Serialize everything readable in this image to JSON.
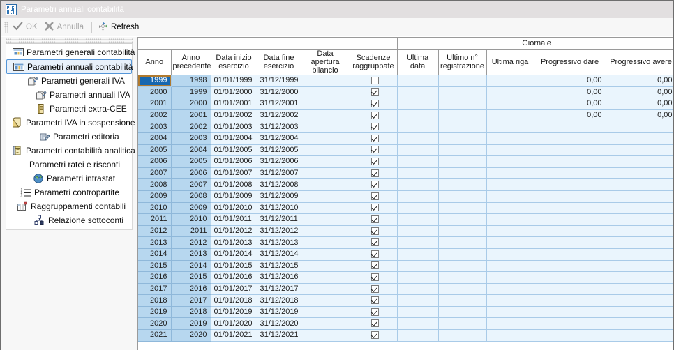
{
  "window": {
    "title": "Parametri annuali contabilità",
    "icon": "app-barcode-icon"
  },
  "toolbar": {
    "ok_label": "OK",
    "cancel_label": "Annulla",
    "refresh_label": "Refresh"
  },
  "sidebar": {
    "items": [
      {
        "label": "Parametri generali contabilità",
        "icon": "form-window-icon",
        "indent": 0,
        "selected": false
      },
      {
        "label": "Parametri annuali contabilità",
        "icon": "form-window-icon",
        "indent": 0,
        "selected": true
      },
      {
        "label": "Parametri generali IVA",
        "icon": "documents-icon",
        "indent": 1,
        "selected": false
      },
      {
        "label": "Parametri annuali IVA",
        "icon": "documents-icon",
        "indent": 2,
        "selected": false
      },
      {
        "label": "Parametri extra-CEE",
        "icon": "book-icon",
        "indent": 2,
        "selected": false
      },
      {
        "label": "Parametri IVA in sospensione",
        "icon": "books-icon",
        "indent": 5,
        "selected": false
      },
      {
        "label": "Parametri editoria",
        "icon": "write-note-icon",
        "indent": 4,
        "selected": false
      },
      {
        "label": "Parametri contabilità analitica",
        "icon": "ledger-icon",
        "indent": 5,
        "selected": false
      },
      {
        "label": "Parametri ratei e risconti",
        "icon": "none-icon",
        "indent": 6,
        "selected": false
      },
      {
        "label": "Parametri intrastat",
        "icon": "globe-icon",
        "indent": 7,
        "selected": false
      },
      {
        "label": "Parametri contropartite",
        "icon": "numbered-list-icon",
        "indent": 8,
        "selected": false
      },
      {
        "label": "Raggruppamenti contabili",
        "icon": "grid-flag-icon",
        "indent": 9,
        "selected": false
      },
      {
        "label": "Relazione sottoconti",
        "icon": "hierarchy-icon",
        "indent": 10,
        "selected": false
      }
    ]
  },
  "grid": {
    "group_headers": [
      {
        "label": "",
        "span": 6
      },
      {
        "label": "Giornale",
        "span": 5
      }
    ],
    "columns": [
      {
        "key": "anno",
        "label": "Anno",
        "width": 47,
        "type": "key"
      },
      {
        "key": "anno_precedente",
        "label": "Anno precedente",
        "width": 57,
        "type": "key"
      },
      {
        "key": "data_inizio_esercizio",
        "label": "Data inizio esercizio",
        "width": 66,
        "type": "text"
      },
      {
        "key": "data_fine_esercizio",
        "label": "Data fine esercizio",
        "width": 63,
        "type": "text"
      },
      {
        "key": "data_apertura_bilancio",
        "label": "Data apertura bilancio",
        "width": 70,
        "type": "text"
      },
      {
        "key": "scadenze_raggruppate",
        "label": "Scadenze raggruppate",
        "width": 68,
        "type": "check"
      },
      {
        "key": "ultima_data",
        "label": "Ultima data",
        "width": 59,
        "type": "text"
      },
      {
        "key": "ultimo_n_registrazione",
        "label": "Ultimo n° registrazione",
        "width": 69,
        "type": "text"
      },
      {
        "key": "ultima_riga",
        "label": "Ultima riga",
        "width": 68,
        "type": "text"
      },
      {
        "key": "progressivo_dare",
        "label": "Progressivo dare",
        "width": 103,
        "type": "num"
      },
      {
        "key": "progressivo_avere",
        "label": "Progressivo avere",
        "width": 101,
        "type": "num"
      }
    ],
    "selected_row": 0,
    "selected_col": "anno",
    "rows": [
      {
        "anno": "1999",
        "anno_precedente": "1998",
        "data_inizio_esercizio": "01/01/1999",
        "data_fine_esercizio": "31/12/1999",
        "data_apertura_bilancio": "",
        "scadenze_raggruppate": false,
        "ultima_data": "",
        "ultimo_n_registrazione": "",
        "ultima_riga": "",
        "progressivo_dare": "0,00",
        "progressivo_avere": "0,00"
      },
      {
        "anno": "2000",
        "anno_precedente": "1999",
        "data_inizio_esercizio": "01/01/2000",
        "data_fine_esercizio": "31/12/2000",
        "data_apertura_bilancio": "",
        "scadenze_raggruppate": true,
        "ultima_data": "",
        "ultimo_n_registrazione": "",
        "ultima_riga": "",
        "progressivo_dare": "0,00",
        "progressivo_avere": "0,00"
      },
      {
        "anno": "2001",
        "anno_precedente": "2000",
        "data_inizio_esercizio": "01/01/2001",
        "data_fine_esercizio": "31/12/2001",
        "data_apertura_bilancio": "",
        "scadenze_raggruppate": true,
        "ultima_data": "",
        "ultimo_n_registrazione": "",
        "ultima_riga": "",
        "progressivo_dare": "0,00",
        "progressivo_avere": "0,00"
      },
      {
        "anno": "2002",
        "anno_precedente": "2001",
        "data_inizio_esercizio": "01/01/2002",
        "data_fine_esercizio": "31/12/2002",
        "data_apertura_bilancio": "",
        "scadenze_raggruppate": true,
        "ultima_data": "",
        "ultimo_n_registrazione": "",
        "ultima_riga": "",
        "progressivo_dare": "0,00",
        "progressivo_avere": "0,00"
      },
      {
        "anno": "2003",
        "anno_precedente": "2002",
        "data_inizio_esercizio": "01/01/2003",
        "data_fine_esercizio": "31/12/2003",
        "data_apertura_bilancio": "",
        "scadenze_raggruppate": true,
        "ultima_data": "",
        "ultimo_n_registrazione": "",
        "ultima_riga": "",
        "progressivo_dare": "",
        "progressivo_avere": ""
      },
      {
        "anno": "2004",
        "anno_precedente": "2003",
        "data_inizio_esercizio": "01/01/2004",
        "data_fine_esercizio": "31/12/2004",
        "data_apertura_bilancio": "",
        "scadenze_raggruppate": true,
        "ultima_data": "",
        "ultimo_n_registrazione": "",
        "ultima_riga": "",
        "progressivo_dare": "",
        "progressivo_avere": ""
      },
      {
        "anno": "2005",
        "anno_precedente": "2004",
        "data_inizio_esercizio": "01/01/2005",
        "data_fine_esercizio": "31/12/2005",
        "data_apertura_bilancio": "",
        "scadenze_raggruppate": true,
        "ultima_data": "",
        "ultimo_n_registrazione": "",
        "ultima_riga": "",
        "progressivo_dare": "",
        "progressivo_avere": ""
      },
      {
        "anno": "2006",
        "anno_precedente": "2005",
        "data_inizio_esercizio": "01/01/2006",
        "data_fine_esercizio": "31/12/2006",
        "data_apertura_bilancio": "",
        "scadenze_raggruppate": true,
        "ultima_data": "",
        "ultimo_n_registrazione": "",
        "ultima_riga": "",
        "progressivo_dare": "",
        "progressivo_avere": ""
      },
      {
        "anno": "2007",
        "anno_precedente": "2006",
        "data_inizio_esercizio": "01/01/2007",
        "data_fine_esercizio": "31/12/2007",
        "data_apertura_bilancio": "",
        "scadenze_raggruppate": true,
        "ultima_data": "",
        "ultimo_n_registrazione": "",
        "ultima_riga": "",
        "progressivo_dare": "",
        "progressivo_avere": ""
      },
      {
        "anno": "2008",
        "anno_precedente": "2007",
        "data_inizio_esercizio": "01/01/2008",
        "data_fine_esercizio": "31/12/2008",
        "data_apertura_bilancio": "",
        "scadenze_raggruppate": true,
        "ultima_data": "",
        "ultimo_n_registrazione": "",
        "ultima_riga": "",
        "progressivo_dare": "",
        "progressivo_avere": ""
      },
      {
        "anno": "2009",
        "anno_precedente": "2008",
        "data_inizio_esercizio": "01/01/2009",
        "data_fine_esercizio": "31/12/2009",
        "data_apertura_bilancio": "",
        "scadenze_raggruppate": true,
        "ultima_data": "",
        "ultimo_n_registrazione": "",
        "ultima_riga": "",
        "progressivo_dare": "",
        "progressivo_avere": ""
      },
      {
        "anno": "2010",
        "anno_precedente": "2009",
        "data_inizio_esercizio": "01/01/2010",
        "data_fine_esercizio": "31/12/2010",
        "data_apertura_bilancio": "",
        "scadenze_raggruppate": true,
        "ultima_data": "",
        "ultimo_n_registrazione": "",
        "ultima_riga": "",
        "progressivo_dare": "",
        "progressivo_avere": ""
      },
      {
        "anno": "2011",
        "anno_precedente": "2010",
        "data_inizio_esercizio": "01/01/2011",
        "data_fine_esercizio": "31/12/2011",
        "data_apertura_bilancio": "",
        "scadenze_raggruppate": true,
        "ultima_data": "",
        "ultimo_n_registrazione": "",
        "ultima_riga": "",
        "progressivo_dare": "",
        "progressivo_avere": ""
      },
      {
        "anno": "2012",
        "anno_precedente": "2011",
        "data_inizio_esercizio": "01/01/2012",
        "data_fine_esercizio": "31/12/2012",
        "data_apertura_bilancio": "",
        "scadenze_raggruppate": true,
        "ultima_data": "",
        "ultimo_n_registrazione": "",
        "ultima_riga": "",
        "progressivo_dare": "",
        "progressivo_avere": ""
      },
      {
        "anno": "2013",
        "anno_precedente": "2012",
        "data_inizio_esercizio": "01/01/2013",
        "data_fine_esercizio": "31/12/2013",
        "data_apertura_bilancio": "",
        "scadenze_raggruppate": true,
        "ultima_data": "",
        "ultimo_n_registrazione": "",
        "ultima_riga": "",
        "progressivo_dare": "",
        "progressivo_avere": ""
      },
      {
        "anno": "2014",
        "anno_precedente": "2013",
        "data_inizio_esercizio": "01/01/2014",
        "data_fine_esercizio": "31/12/2014",
        "data_apertura_bilancio": "",
        "scadenze_raggruppate": true,
        "ultima_data": "",
        "ultimo_n_registrazione": "",
        "ultima_riga": "",
        "progressivo_dare": "",
        "progressivo_avere": ""
      },
      {
        "anno": "2015",
        "anno_precedente": "2014",
        "data_inizio_esercizio": "01/01/2015",
        "data_fine_esercizio": "31/12/2015",
        "data_apertura_bilancio": "",
        "scadenze_raggruppate": true,
        "ultima_data": "",
        "ultimo_n_registrazione": "",
        "ultima_riga": "",
        "progressivo_dare": "",
        "progressivo_avere": ""
      },
      {
        "anno": "2016",
        "anno_precedente": "2015",
        "data_inizio_esercizio": "01/01/2016",
        "data_fine_esercizio": "31/12/2016",
        "data_apertura_bilancio": "",
        "scadenze_raggruppate": true,
        "ultima_data": "",
        "ultimo_n_registrazione": "",
        "ultima_riga": "",
        "progressivo_dare": "",
        "progressivo_avere": ""
      },
      {
        "anno": "2017",
        "anno_precedente": "2016",
        "data_inizio_esercizio": "01/01/2017",
        "data_fine_esercizio": "31/12/2017",
        "data_apertura_bilancio": "",
        "scadenze_raggruppate": true,
        "ultima_data": "",
        "ultimo_n_registrazione": "",
        "ultima_riga": "",
        "progressivo_dare": "",
        "progressivo_avere": ""
      },
      {
        "anno": "2018",
        "anno_precedente": "2017",
        "data_inizio_esercizio": "01/01/2018",
        "data_fine_esercizio": "31/12/2018",
        "data_apertura_bilancio": "",
        "scadenze_raggruppate": true,
        "ultima_data": "",
        "ultimo_n_registrazione": "",
        "ultima_riga": "",
        "progressivo_dare": "",
        "progressivo_avere": ""
      },
      {
        "anno": "2019",
        "anno_precedente": "2018",
        "data_inizio_esercizio": "01/01/2019",
        "data_fine_esercizio": "31/12/2019",
        "data_apertura_bilancio": "",
        "scadenze_raggruppate": true,
        "ultima_data": "",
        "ultimo_n_registrazione": "",
        "ultima_riga": "",
        "progressivo_dare": "",
        "progressivo_avere": ""
      },
      {
        "anno": "2020",
        "anno_precedente": "2019",
        "data_inizio_esercizio": "01/01/2020",
        "data_fine_esercizio": "31/12/2020",
        "data_apertura_bilancio": "",
        "scadenze_raggruppate": true,
        "ultima_data": "",
        "ultimo_n_registrazione": "",
        "ultima_riga": "",
        "progressivo_dare": "",
        "progressivo_avere": ""
      },
      {
        "anno": "2021",
        "anno_precedente": "2020",
        "data_inizio_esercizio": "01/01/2021",
        "data_fine_esercizio": "31/12/2021",
        "data_apertura_bilancio": "",
        "scadenze_raggruppate": true,
        "ultima_data": "",
        "ultimo_n_registrazione": "",
        "ultima_riga": "",
        "progressivo_dare": "",
        "progressivo_avere": ""
      }
    ]
  },
  "colors": {
    "titlebar_bg": "#e2dfe0",
    "frame": "#6e6e6e",
    "key_cell_bg": "#b7d7ef",
    "data_cell_bg": "#eaf5fd",
    "selection_bg": "#1667b0",
    "selection_outline": "#b07a2e",
    "nav_selected_border": "#5596d8"
  }
}
